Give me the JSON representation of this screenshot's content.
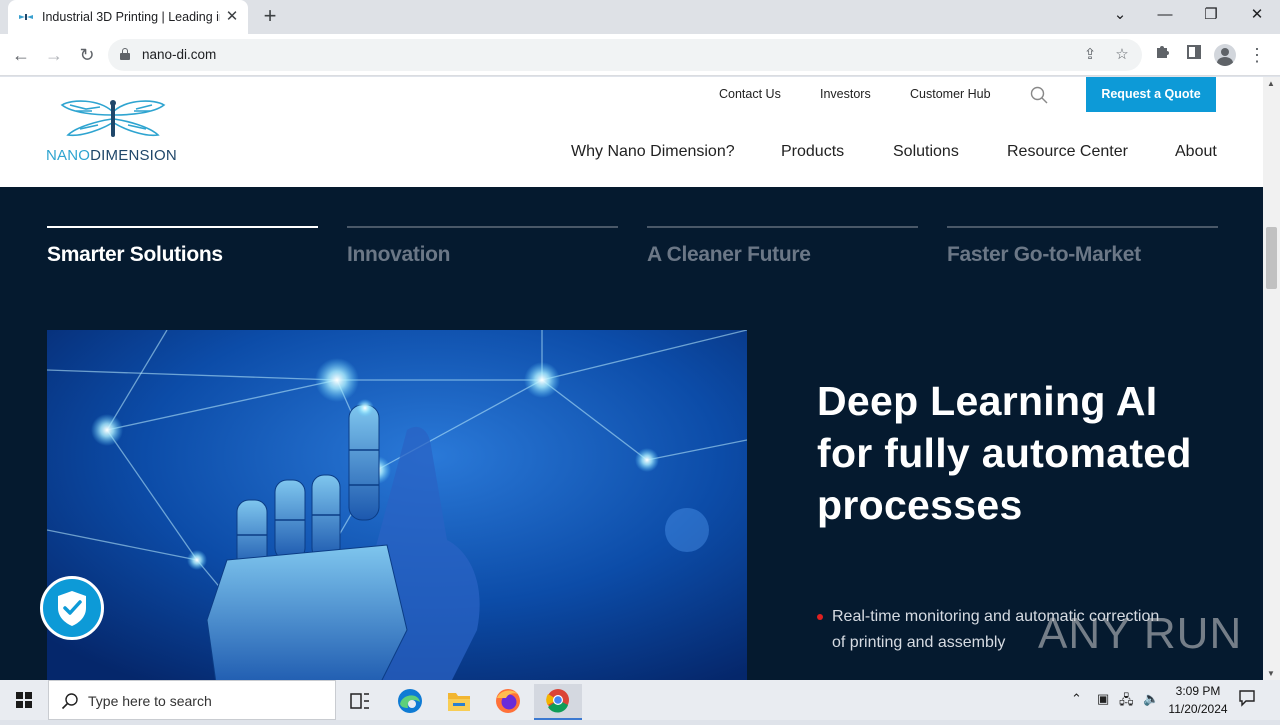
{
  "browser": {
    "tab_title": "Industrial 3D Printing | Leading in",
    "tab_close": "✕",
    "new_tab": "+",
    "url": "nano-di.com",
    "controls": {
      "dropdown": "⌄",
      "minimize": "—",
      "restore": "❐",
      "close": "✕"
    }
  },
  "site": {
    "logo": {
      "nano": "NANO",
      "dimension": "DIMENSION"
    },
    "utility_nav": [
      "Contact Us",
      "Investors",
      "Customer Hub"
    ],
    "quote_button": "Request a Quote",
    "main_nav": [
      "Why Nano Dimension?",
      "Products",
      "Solutions",
      "Resource Center",
      "About"
    ],
    "hero_tabs": [
      {
        "label": "Smarter Solutions",
        "active": true
      },
      {
        "label": "Innovation",
        "active": false
      },
      {
        "label": "A Cleaner Future",
        "active": false
      },
      {
        "label": "Faster Go-to-Market",
        "active": false
      }
    ],
    "headline": "Deep Learning AI for fully automated processes",
    "bullets": [
      "Real-time monitoring and automatic correction of printing and assembly"
    ]
  },
  "overlay": {
    "watermark": "ANY RUN"
  },
  "taskbar": {
    "search_placeholder": "Type here to search",
    "time": "3:09 PM",
    "date": "11/20/2024"
  },
  "colors": {
    "accent": "#0d9ad7",
    "hero_bg": "#051a2f",
    "bullet_red": "#e02020"
  }
}
